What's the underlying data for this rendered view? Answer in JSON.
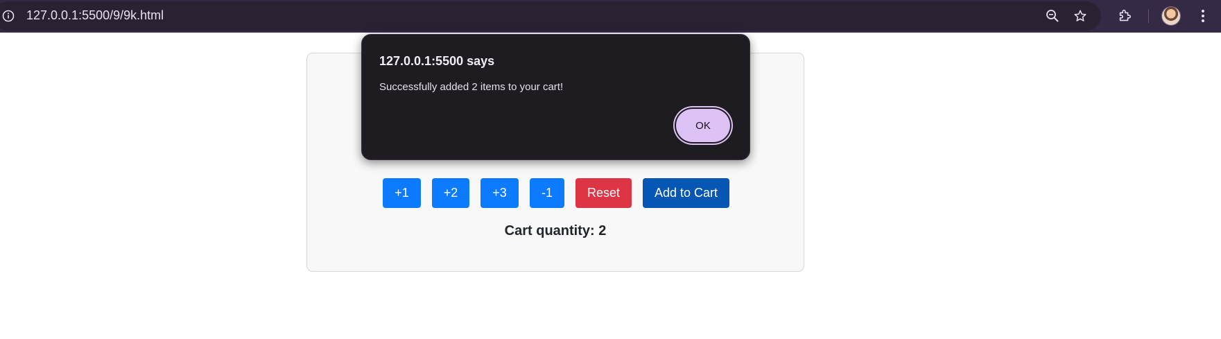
{
  "browser": {
    "url": "127.0.0.1:5500/9/9k.html",
    "icons": [
      "info-icon",
      "zoom-out-icon",
      "star-icon",
      "extensions-icon",
      "profile-avatar",
      "more-menu-icon"
    ]
  },
  "colors": {
    "primary": "#0d7bff",
    "danger": "#dc3545",
    "cart": "#0656b4",
    "dialog_bg": "#1e1b21",
    "ok_bg": "#dcc2f5"
  },
  "controls": {
    "buttons": [
      {
        "label": "+1"
      },
      {
        "label": "+2"
      },
      {
        "label": "+3"
      },
      {
        "label": "-1"
      },
      {
        "label": "Reset"
      },
      {
        "label": "Add to Cart"
      }
    ],
    "quantity_label": "Cart quantity: 2"
  },
  "dialog": {
    "title": "127.0.0.1:5500 says",
    "message": "Successfully added 2 items to your cart!",
    "ok_label": "OK"
  }
}
